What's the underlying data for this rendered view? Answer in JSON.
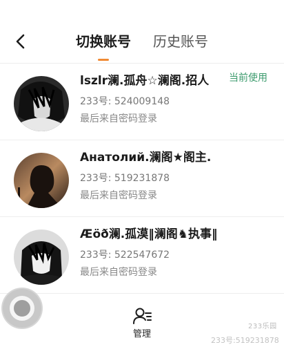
{
  "header": {
    "tabs": [
      {
        "label": "切换账号",
        "active": true
      },
      {
        "label": "历史账号",
        "active": false
      }
    ],
    "accent_color": "#f08a34"
  },
  "accounts": [
    {
      "name": "lszlr澜.孤舟☆澜阁.招人",
      "uid": "233号: 524009148",
      "login": "最后来自密码登录",
      "badge": "当前使用"
    },
    {
      "name": "Анатолий.澜阁★阁主.",
      "uid": "233号: 519231878",
      "login": "最后来自密码登录",
      "badge": ""
    },
    {
      "name": "Æöð澜.孤漠‖澜阁♞执事‖",
      "uid": "233号: 522547672",
      "login": "最后来自密码登录",
      "badge": ""
    }
  ],
  "footer": {
    "manage_label": "管理",
    "manage_icon": "user-list-icon",
    "watermark_logo": "233乐园",
    "watermark": "233号:519231878"
  },
  "colors": {
    "current_badge": "#3b9a6c"
  }
}
